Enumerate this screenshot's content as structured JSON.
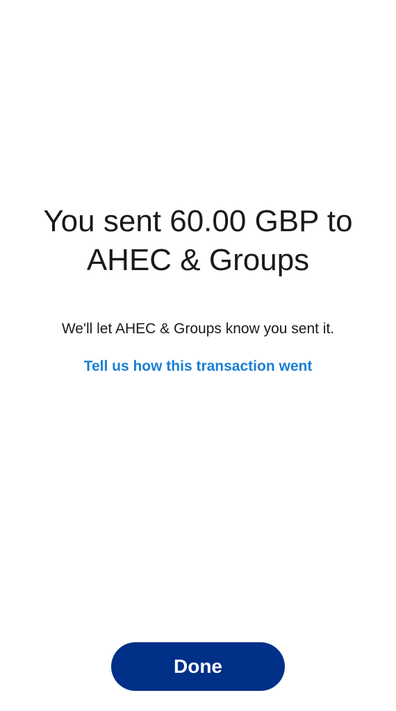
{
  "confirmation": {
    "title": "You sent 60.00 GBP to AHEC & Groups",
    "message": "We'll let AHEC & Groups know you sent it.",
    "feedback_link": "Tell us how this transaction went"
  },
  "actions": {
    "done_label": "Done"
  },
  "colors": {
    "primary_button": "#003087",
    "link": "#1a7fd4",
    "text": "#1a1a1a",
    "background": "#ffffff"
  }
}
